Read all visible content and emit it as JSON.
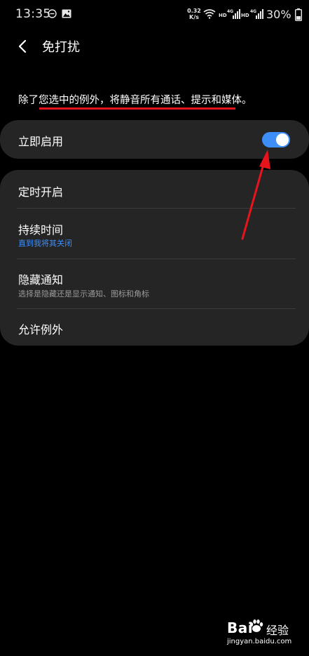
{
  "status_bar": {
    "time": "13:35",
    "net_speed_value": "0.32",
    "net_speed_unit": "K/s",
    "sim1_label": "HD",
    "sim1_network": "4G",
    "sim2_label": "HD",
    "sim2_network": "4G",
    "battery": "30%",
    "icons": [
      "dnd-icon",
      "gallery-icon",
      "wifi-icon",
      "signal-icon",
      "battery-icon"
    ]
  },
  "header": {
    "title": "免打扰",
    "back_icon": "chevron-left-icon"
  },
  "description": "除了您选中的例外，将静音所有通话、提示和媒体。",
  "enable_card": {
    "label": "立即启用",
    "toggle_on": true,
    "accent_color": "#3e8ef7"
  },
  "settings": {
    "items": [
      {
        "label": "定时开启"
      },
      {
        "label": "持续时间",
        "sublabel": "直到我将其关闭",
        "sublabel_color": "#3e8ef7"
      },
      {
        "label": "隐藏通知",
        "sublabel": "选择是隐藏还是显示通知、图标和角标",
        "sublabel_color": "#9a9a9a"
      },
      {
        "label": "允许例外"
      }
    ]
  },
  "watermark": {
    "brand": "Bai",
    "brand2": "经验",
    "url": "jingyan.baidu.com"
  },
  "colors": {
    "background": "#000000",
    "card": "#252525",
    "annotation_red": "#e8141b"
  }
}
